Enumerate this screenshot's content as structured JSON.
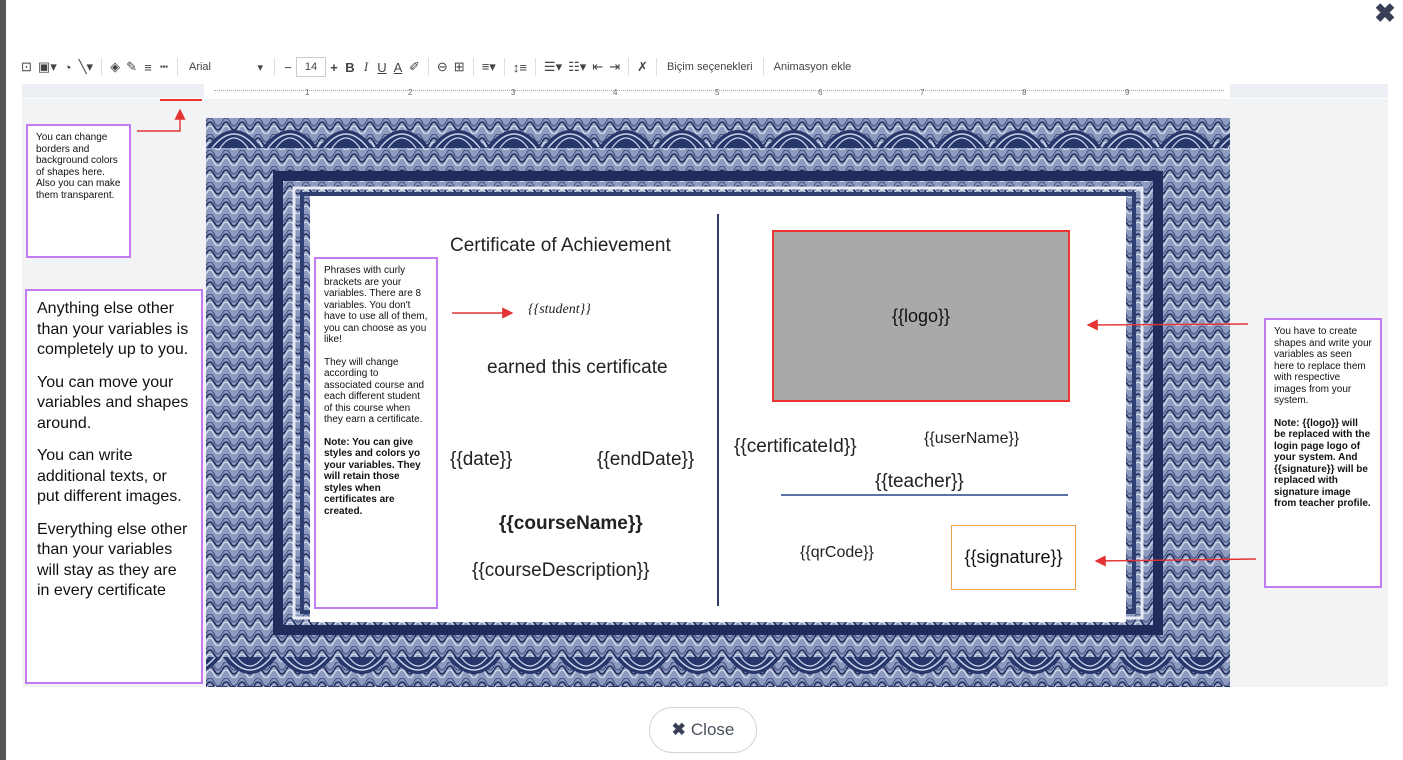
{
  "dialog": {
    "close_x": "✖",
    "close_button_label": "Close",
    "close_button_icon": "✖"
  },
  "toolbar": {
    "font_name": "Arial",
    "font_size": "14",
    "minus": "−",
    "plus": "+",
    "bold": "B",
    "italic": "I",
    "underline": "U",
    "text_color": "A",
    "format_options": "Biçim seçenekleri",
    "add_animation": "Animasyon ekle"
  },
  "ruler": {
    "ticks": [
      "1",
      "2",
      "3",
      "4",
      "5",
      "6",
      "7",
      "8",
      "9"
    ]
  },
  "notes": {
    "borders": "You can change borders and background colors of shapes here. Also you can make them transparent.",
    "anything_else": [
      "Anything else other than your variables is completely up to you.",
      "You can move your variables and shapes around.",
      "You can write additional texts, or put different images.",
      "Everything else other than your variables will stay as they are in every certificate"
    ],
    "phrases_p1": "Phrases with curly brackets are your variables. There are 8 variables. You don't have to use all of them, you can choose as you like!",
    "phrases_p2": "They will change according to associated course and each different student of this course when they earn a certificate.",
    "phrases_note": "Note: You can give styles and colors yo your variables. They will retain those styles when certificates are created.",
    "shapes_p1": "You have to create shapes and write your variables as seen here to replace them with respective images from your system.",
    "shapes_note": "Note: {{logo}} will be replaced with the login page logo of your system. And {{signature}} will be replaced with signature image from teacher profile."
  },
  "certificate": {
    "title": "Certificate of Achievement",
    "student": "{{student}}",
    "earned": "earned this certificate",
    "date": "{{date}}",
    "end_date": "{{endDate}}",
    "course_name": "{{courseName}}",
    "course_description": "{{courseDescription}}",
    "logo": "{{logo}}",
    "certificate_id": "{{certificateId}}",
    "user_name": "{{userName}}",
    "teacher": "{{teacher}}",
    "qr_code": "{{qrCode}}",
    "signature": "{{signature}}"
  },
  "colors": {
    "note_border": "#c17cf2",
    "arrow": "#e33333",
    "frame": "#2f3f72",
    "logo_fill": "#a9a9a9"
  }
}
